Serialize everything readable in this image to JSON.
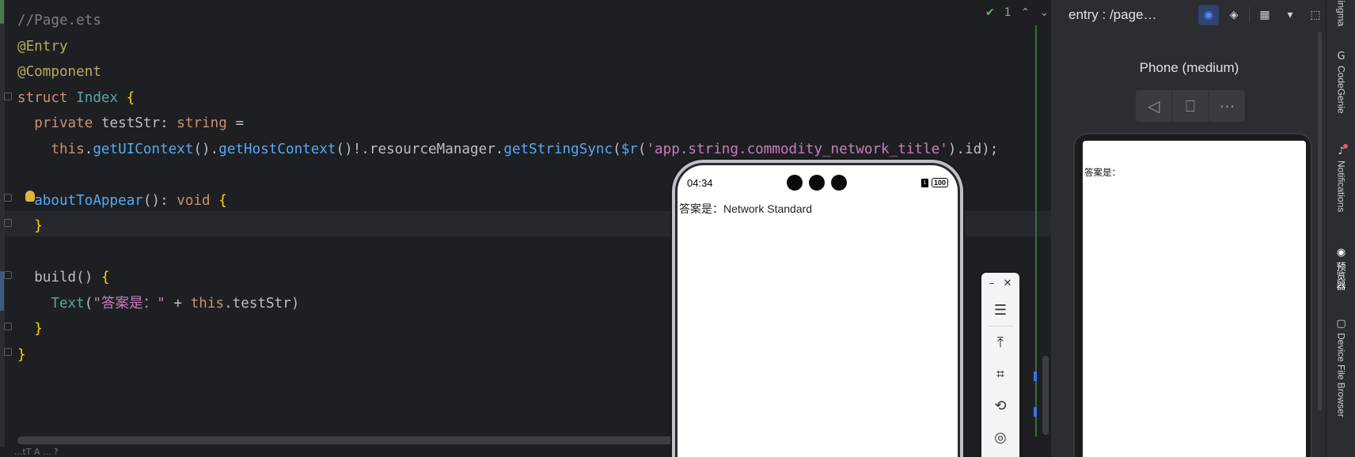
{
  "editor": {
    "lines": [
      {
        "tokens": [
          {
            "c": "cm",
            "t": "//Page.ets"
          }
        ]
      },
      {
        "tokens": [
          {
            "c": "an",
            "t": "@Entry"
          }
        ]
      },
      {
        "tokens": [
          {
            "c": "an",
            "t": "@Component"
          }
        ]
      },
      {
        "tokens": [
          {
            "c": "kw",
            "t": "struct "
          },
          {
            "c": "cl",
            "t": "Index "
          },
          {
            "c": "br-y",
            "t": "{"
          }
        ]
      },
      {
        "tokens": [
          {
            "c": "id",
            "t": "  "
          },
          {
            "c": "kw",
            "t": "private "
          },
          {
            "c": "id",
            "t": "testStr: "
          },
          {
            "c": "kw",
            "t": "string "
          },
          {
            "c": "id",
            "t": "="
          }
        ]
      },
      {
        "tokens": [
          {
            "c": "id",
            "t": "    "
          },
          {
            "c": "th",
            "t": "this"
          },
          {
            "c": "id",
            "t": "."
          },
          {
            "c": "fn",
            "t": "getUIContext"
          },
          {
            "c": "id",
            "t": "()."
          },
          {
            "c": "fn",
            "t": "getHostContext"
          },
          {
            "c": "id",
            "t": "()!.resourceManager."
          },
          {
            "c": "fn",
            "t": "getStringSync"
          },
          {
            "c": "id",
            "t": "("
          },
          {
            "c": "fn",
            "t": "$r"
          },
          {
            "c": "id",
            "t": "("
          },
          {
            "c": "fld",
            "t": "'app.string.commodity_network_title'"
          },
          {
            "c": "id",
            "t": ").id);"
          }
        ]
      },
      {
        "tokens": [
          {
            "c": "id",
            "t": ""
          }
        ]
      },
      {
        "tokens": [
          {
            "c": "id",
            "t": "  "
          },
          {
            "c": "fn",
            "t": "aboutToAppear"
          },
          {
            "c": "id",
            "t": "(): "
          },
          {
            "c": "kw",
            "t": "void "
          },
          {
            "c": "br-y",
            "t": "{"
          }
        ]
      },
      {
        "tokens": [
          {
            "c": "id",
            "t": "  "
          },
          {
            "c": "br-y",
            "t": "}"
          }
        ]
      },
      {
        "tokens": [
          {
            "c": "id",
            "t": ""
          }
        ]
      },
      {
        "tokens": [
          {
            "c": "id",
            "t": "  "
          },
          {
            "c": "id",
            "t": "build"
          },
          {
            "c": "id",
            "t": "() "
          },
          {
            "c": "br-y",
            "t": "{"
          }
        ]
      },
      {
        "tokens": [
          {
            "c": "id",
            "t": "    "
          },
          {
            "c": "cl",
            "t": "Text"
          },
          {
            "c": "id",
            "t": "("
          },
          {
            "c": "fld",
            "t": "\"答案是：\""
          },
          {
            "c": "id",
            "t": " + "
          },
          {
            "c": "th",
            "t": "this"
          },
          {
            "c": "id",
            "t": ".testStr)"
          }
        ]
      },
      {
        "tokens": [
          {
            "c": "id",
            "t": "  "
          },
          {
            "c": "br-y",
            "t": "}"
          }
        ]
      },
      {
        "tokens": [
          {
            "c": "br-y",
            "t": "}"
          }
        ]
      }
    ],
    "inspection_count": "1",
    "bottom_text": "...tT  A ... ?"
  },
  "phone": {
    "time": "04:34",
    "battery": "100",
    "sim": "1",
    "text": "答案是：Network Standard"
  },
  "float_toolbar": {
    "min_label": "–",
    "close_label": "✕",
    "buttons": [
      "☰",
      "⤒",
      "⌗",
      "⟲",
      "◎"
    ]
  },
  "preview": {
    "title": "entry : /page…",
    "device": "Phone (medium)",
    "phone_text": "答案是："
  },
  "strip": {
    "items": [
      {
        "icon": "≡",
        "label": "Lingma"
      },
      {
        "icon": "G",
        "label": "CodeGenie"
      },
      {
        "icon": "♪",
        "label": "Notifications"
      },
      {
        "icon": "◉",
        "label": "预览器"
      },
      {
        "icon": "▢",
        "label": "Device File Browser"
      }
    ]
  }
}
